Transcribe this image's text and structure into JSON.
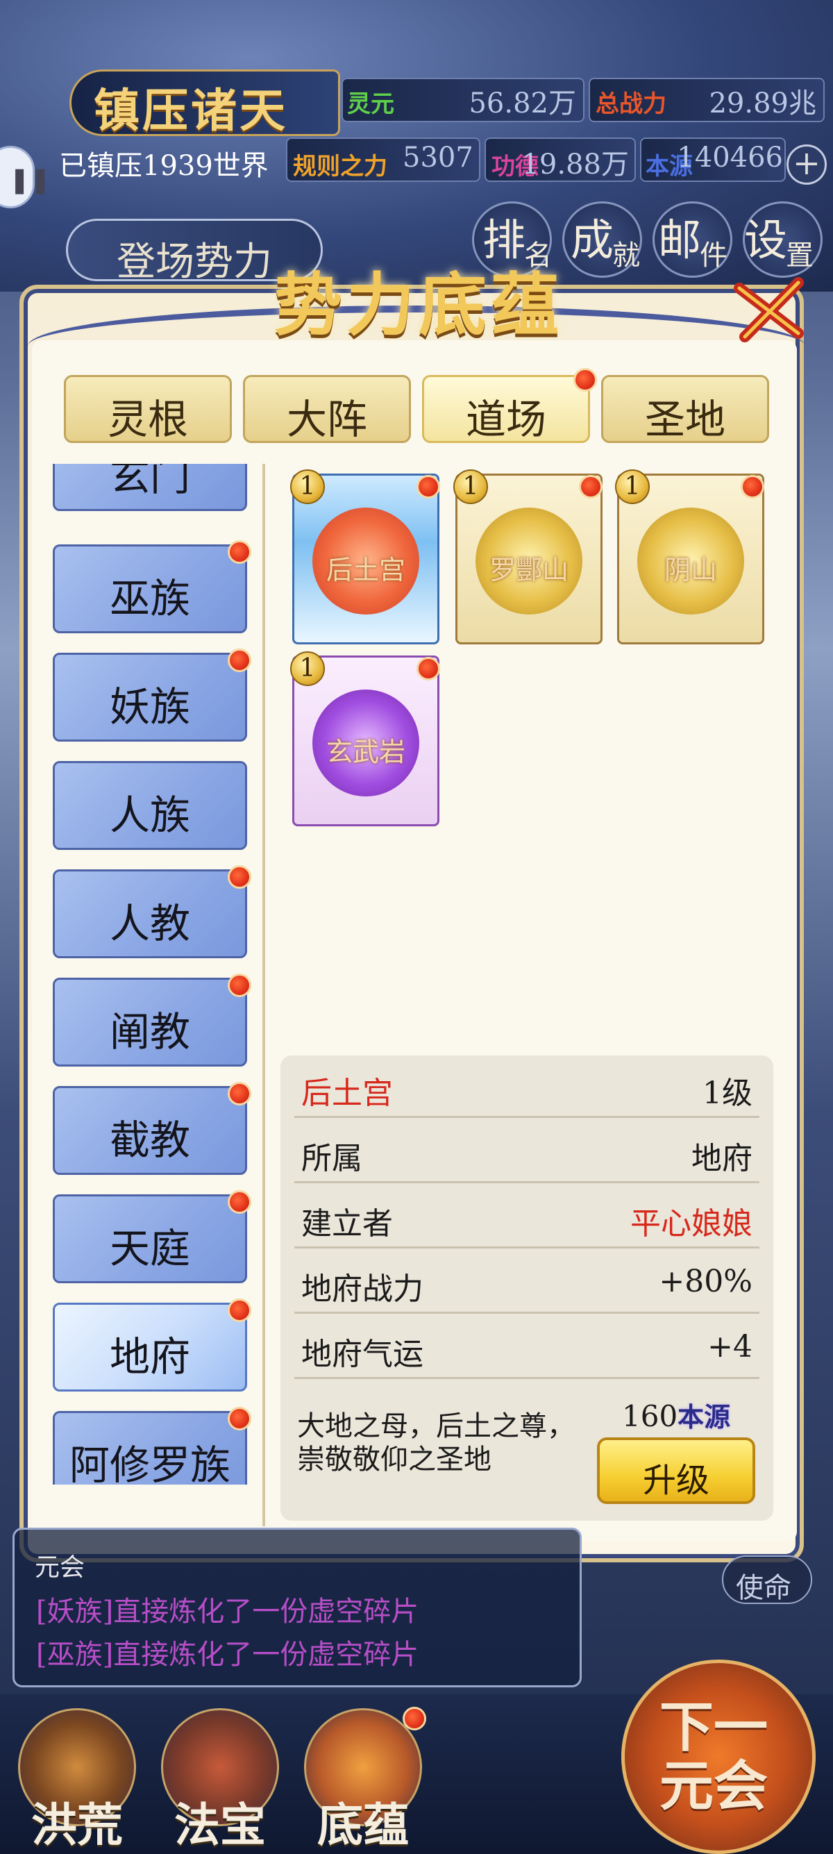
{
  "hud": {
    "title": "镇压诸天",
    "lingyuan_label": "灵元",
    "lingyuan_value": "56.82万",
    "power_label": "总战力",
    "power_value": "29.89兆",
    "world_text": "已镇压1939世界",
    "rule_label": "规则之力",
    "rule_value": "5307",
    "merit_label": "功德",
    "merit_value": "19.88万",
    "source_label": "本源",
    "source_value": "140466",
    "faction_button": "登场势力",
    "menu": [
      {
        "big": "排",
        "small": "名"
      },
      {
        "big": "成",
        "small": "就"
      },
      {
        "big": "邮",
        "small": "件"
      },
      {
        "big": "设",
        "small": "置"
      }
    ]
  },
  "panel": {
    "title": "势力底蕴",
    "tabs": [
      "灵根",
      "大阵",
      "道场",
      "圣地"
    ],
    "active_tab": "道场",
    "factions": [
      "玄门",
      "巫族",
      "妖族",
      "人族",
      "人教",
      "阐教",
      "截教",
      "天庭",
      "地府",
      "阿修罗族"
    ],
    "active_faction": "地府",
    "cards": [
      {
        "name": "后土宫",
        "level": "1",
        "style": "orange-blue"
      },
      {
        "name": "罗酆山",
        "level": "1",
        "style": "gold"
      },
      {
        "name": "阴山",
        "level": "1",
        "style": "gold"
      },
      {
        "name": "玄武岩",
        "level": "1",
        "style": "purple"
      }
    ],
    "detail": {
      "name": "后土宫",
      "level": "1级",
      "rows": [
        {
          "label": "所属",
          "value": "地府"
        },
        {
          "label": "建立者",
          "value": "平心娘娘"
        },
        {
          "label": "地府战力",
          "value": "+80%"
        },
        {
          "label": "地府气运",
          "value": "+4"
        }
      ],
      "description_line1": "大地之母，后土之尊，",
      "description_line2": "崇敬敬仰之圣地",
      "cost_amount": "160",
      "cost_currency": "本源",
      "upgrade_label": "升级"
    }
  },
  "log": {
    "header": "元会",
    "lines": [
      "[妖族]直接炼化了一份虚空碎片",
      "[巫族]直接炼化了一份虚空碎片"
    ],
    "mission_label": "使命"
  },
  "bottom": {
    "nav": [
      "洪荒",
      "法宝",
      "底蕴"
    ],
    "next_line1": "下一",
    "next_line2": "元会"
  },
  "colors": {
    "accent_gold": "#f2c85a",
    "red_text": "#d7281c",
    "list_blue": "#8aa6e4"
  }
}
